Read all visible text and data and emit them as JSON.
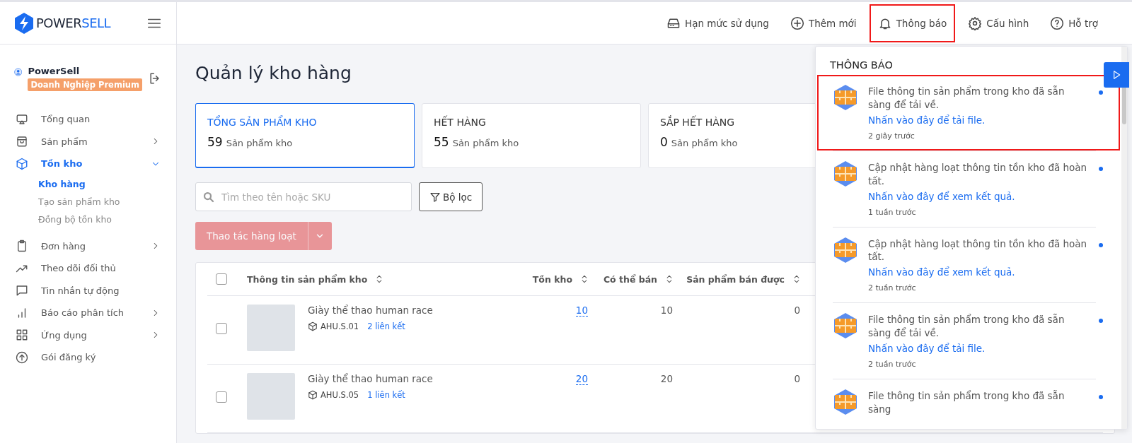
{
  "logo": {
    "text_dark": "POWER",
    "text_accent": "SELL"
  },
  "user": {
    "name": "PowerSell",
    "plan": "Doanh Nghiệp Premium"
  },
  "sidebar": {
    "items": [
      {
        "label": "Tổng quan",
        "selected": false
      },
      {
        "label": "Sản phẩm",
        "selected": false,
        "expanded": false
      },
      {
        "label": "Tồn kho",
        "selected": true,
        "expanded": true,
        "children": [
          {
            "label": "Kho hàng",
            "selected": true
          },
          {
            "label": "Tạo sản phẩm kho",
            "selected": false
          },
          {
            "label": "Đồng bộ tồn kho",
            "selected": false
          }
        ]
      },
      {
        "label": "Đơn hàng",
        "selected": false,
        "expanded": false
      },
      {
        "label": "Theo dõi đối thủ",
        "selected": false
      },
      {
        "label": "Tin nhắn tự động",
        "selected": false
      },
      {
        "label": "Báo cáo phân tích",
        "selected": false,
        "expanded": false
      },
      {
        "label": "Ứng dụng",
        "selected": false,
        "expanded": false
      },
      {
        "label": "Gói đăng ký",
        "selected": false
      }
    ]
  },
  "top_nav": [
    {
      "label": "Hạn mức sử dụng",
      "highlighted": false
    },
    {
      "label": "Thêm mới",
      "highlighted": false
    },
    {
      "label": "Thông báo",
      "highlighted": true
    },
    {
      "label": "Cấu hình",
      "highlighted": false
    },
    {
      "label": "Hỗ trợ",
      "highlighted": false
    }
  ],
  "page_title": "Quản lý kho hàng",
  "summary_cards": [
    {
      "title": "TỔNG SẢN PHẨM KHO",
      "count": "59",
      "unit": "Sản phẩm kho",
      "selected": true
    },
    {
      "title": "HẾT HÀNG",
      "count": "55",
      "unit": "Sản phẩm kho",
      "selected": false
    },
    {
      "title": "SẮP HẾT HÀNG",
      "count": "0",
      "unit": "Sản phẩm kho",
      "selected": false
    }
  ],
  "search": {
    "placeholder": "Tìm theo tên hoặc SKU"
  },
  "filter_button": "Bộ lọc",
  "bulk_button": {
    "label": "Thao tác hàng loạt",
    "disabled": true
  },
  "table": {
    "all_checked": false,
    "columns": [
      "Thông tin sản phẩm kho",
      "Tồn kho",
      "Có thể bán",
      "Sản phẩm bán được"
    ],
    "rows": [
      {
        "checked": false,
        "name": "Giày thể thao human race",
        "sku": "AHU.S.01",
        "links": "2 liên kết",
        "stock": "10",
        "available": "10",
        "sold": "0"
      },
      {
        "checked": false,
        "name": "Giày thể thao human race",
        "sku": "AHU.S.05",
        "links": "1 liên kết",
        "stock": "20",
        "available": "20",
        "sold": "0"
      }
    ]
  },
  "notifications": {
    "title": "THÔNG BÁO",
    "items": [
      {
        "message": "File thông tin sản phẩm trong kho đã sẵn sàng để tải về.",
        "link": "Nhấn vào đây để tải file.",
        "time": "2 giây trước",
        "unread": true,
        "highlighted": true
      },
      {
        "message": "Cập nhật hàng loạt thông tin tồn kho đã hoàn tất.",
        "link": "Nhấn vào đây để xem kết quả.",
        "time": "1 tuần trước",
        "unread": true,
        "highlighted": false
      },
      {
        "message": "Cập nhật hàng loạt thông tin tồn kho đã hoàn tất.",
        "link": "Nhấn vào đây để xem kết quả.",
        "time": "2 tuần trước",
        "unread": true,
        "highlighted": false
      },
      {
        "message": "File thông tin sản phẩm trong kho đã sẵn sàng để tải về.",
        "link": "Nhấn vào đây để tải file.",
        "time": "2 tuần trước",
        "unread": true,
        "highlighted": false
      },
      {
        "message": "File thông tin sản phẩm trong kho đã sẵn sàng",
        "unread": true,
        "highlighted": false
      }
    ]
  }
}
